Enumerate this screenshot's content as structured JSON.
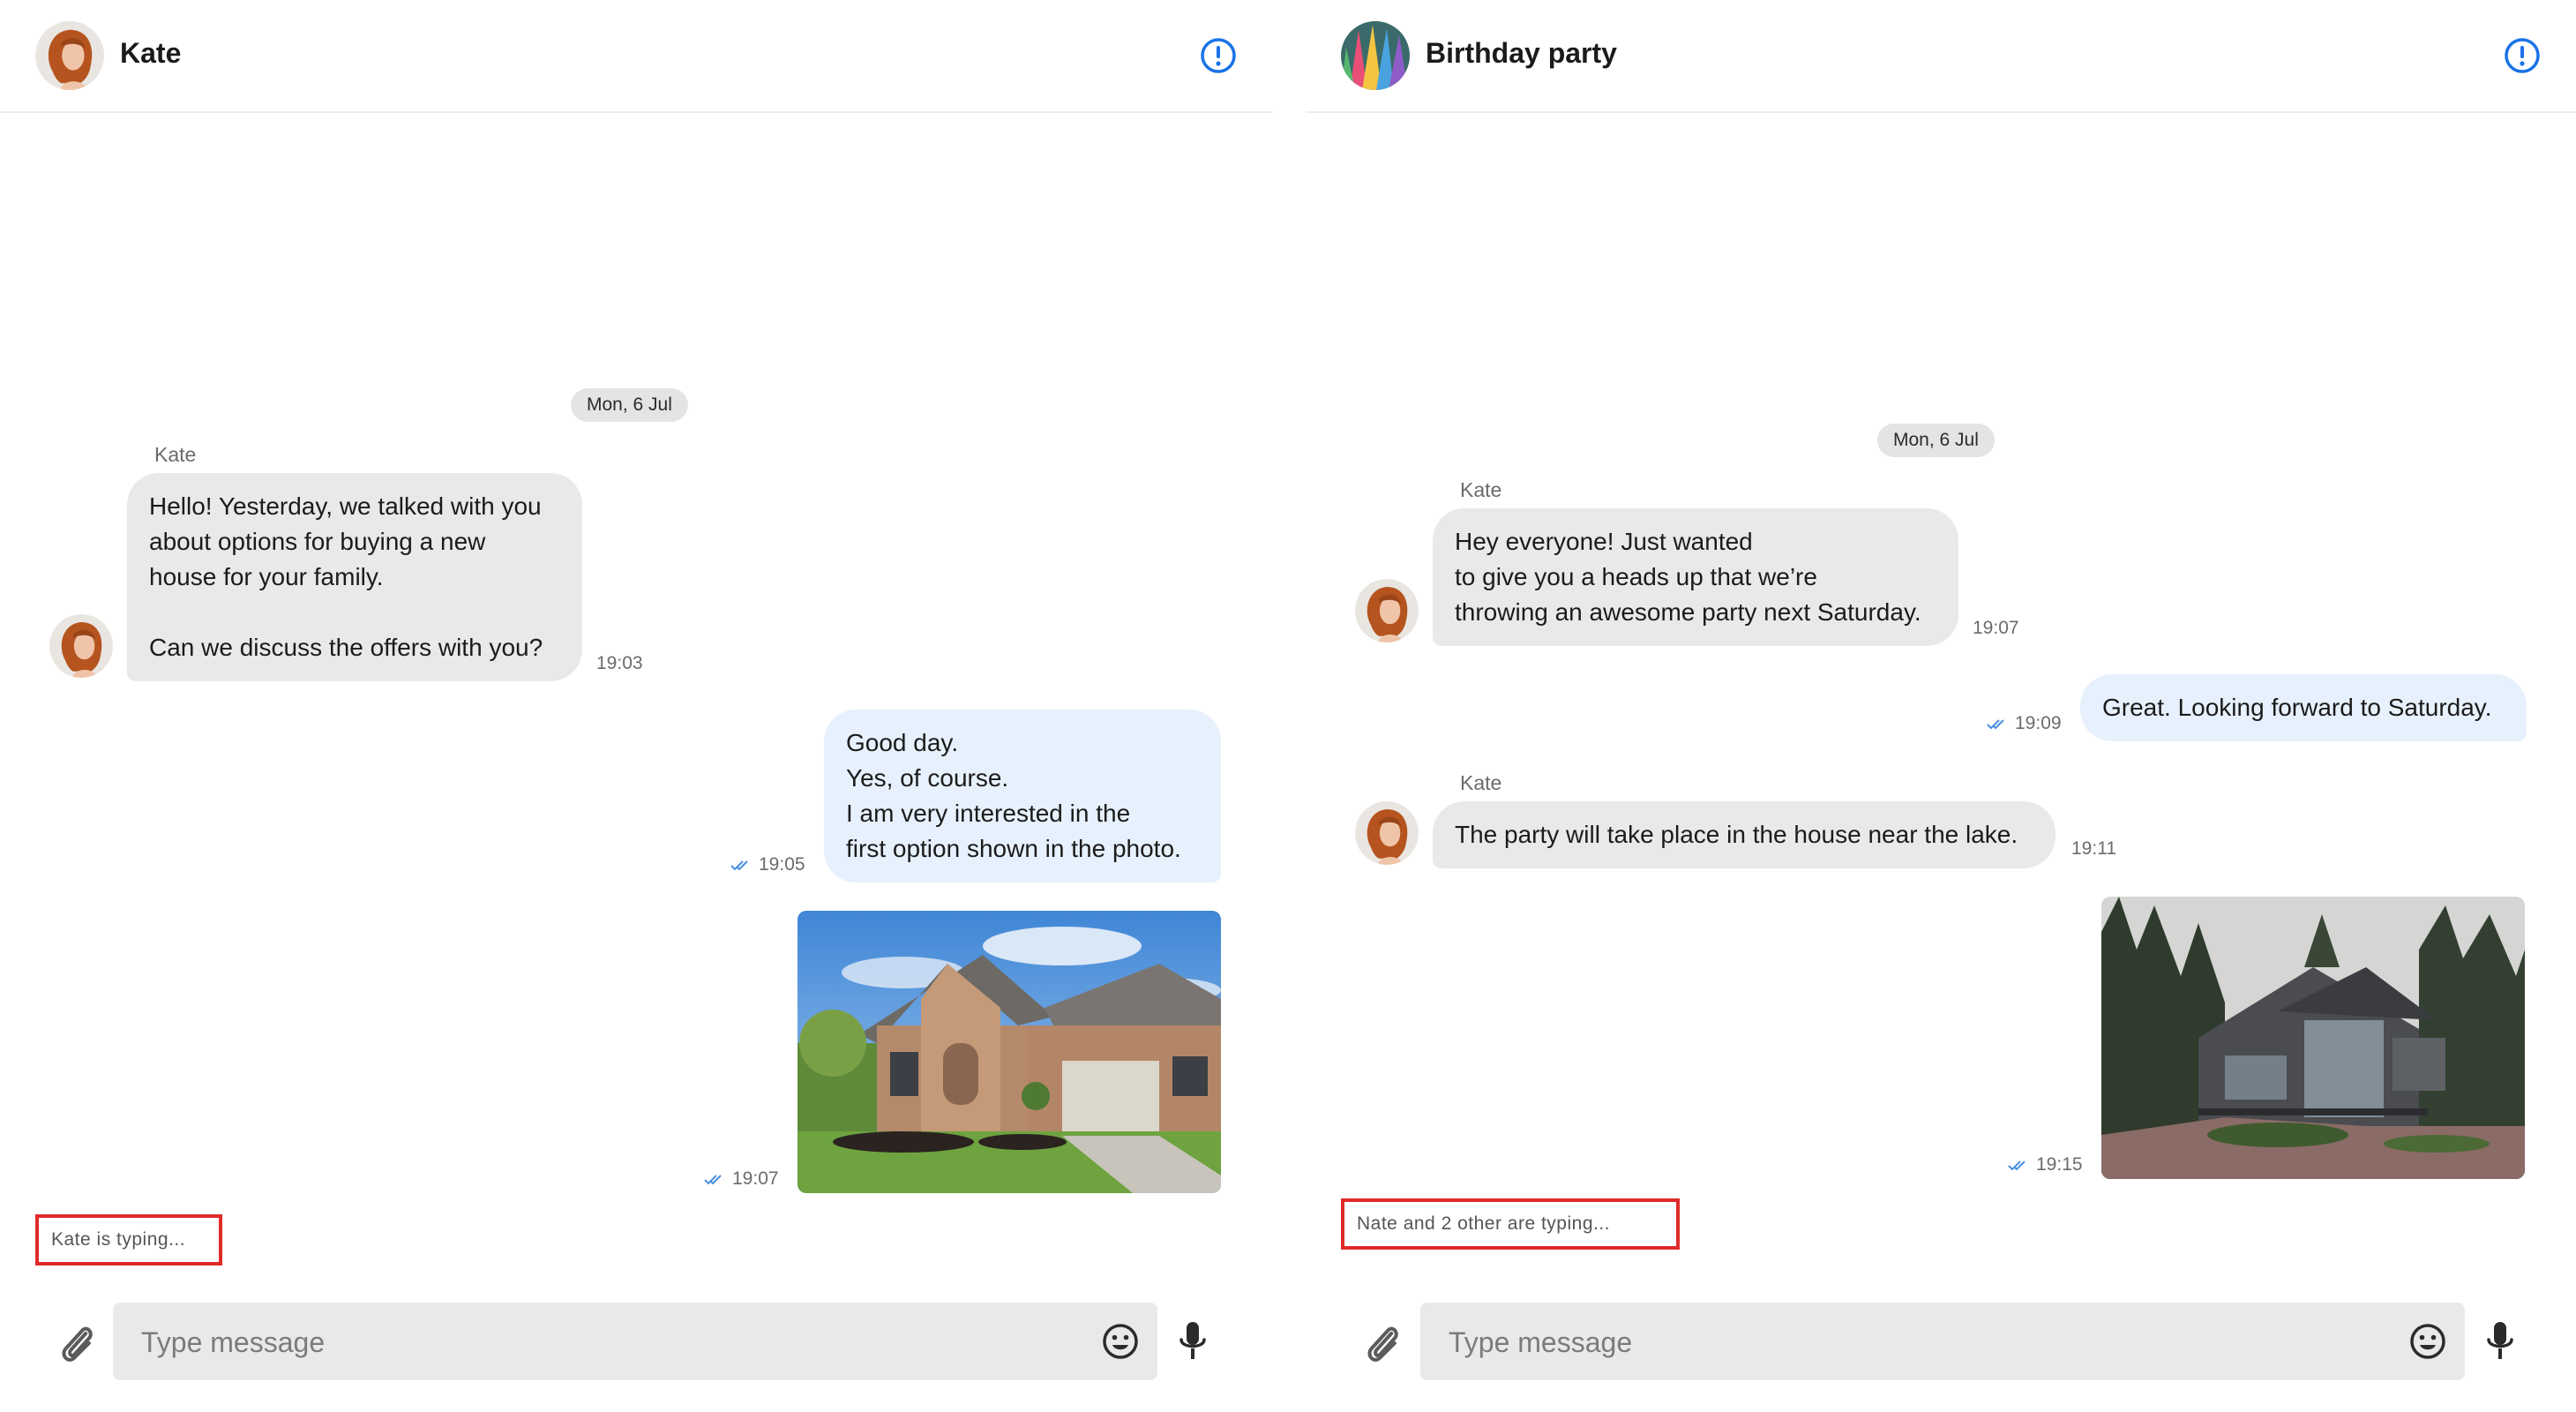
{
  "left": {
    "header": {
      "title": "Kate",
      "avatar_icon": "kate-avatar",
      "info_icon": "info-icon"
    },
    "date": "Mon, 6 Jul",
    "messages": [
      {
        "sender": "Kate",
        "text": "Hello! Yesterday, we talked with you\nabout options for buying a new\nhouse for your family.\n\nCan we discuss the offers with you?",
        "time": "19:03"
      },
      {
        "text": "Good day.\nYes, of course.\nI am very interested in the\nfirst option shown in the photo.",
        "time": "19:05"
      },
      {
        "image": "brick-house-photo",
        "time": "19:07"
      }
    ],
    "typing": "Kate is typing...",
    "composer": {
      "placeholder": "Type message"
    }
  },
  "right": {
    "header": {
      "title": "Birthday party",
      "avatar_icon": "balloons-avatar",
      "info_icon": "info-icon"
    },
    "date": "Mon, 6 Jul",
    "messages": [
      {
        "sender": "Kate",
        "text": "Hey everyone! Just wanted\nto give you a heads up that we’re\nthrowing an awesome party next Saturday.",
        "time": "19:07"
      },
      {
        "text": "Great. Looking forward to Saturday.",
        "time": "19:09"
      },
      {
        "sender": "Kate",
        "text": "The party will take place in the house near the lake.",
        "time": "19:11"
      },
      {
        "image": "lake-house-photo",
        "time": "19:15"
      }
    ],
    "typing": "Nate and 2 other are typing...",
    "composer": {
      "placeholder": "Type message"
    }
  },
  "colors": {
    "accent": "#1a73e8",
    "incoming_bubble": "#e8e9eb",
    "outgoing_bubble": "#e7f1fd",
    "highlight_border": "#e02a2a",
    "read_check": "#4a8fe0"
  }
}
